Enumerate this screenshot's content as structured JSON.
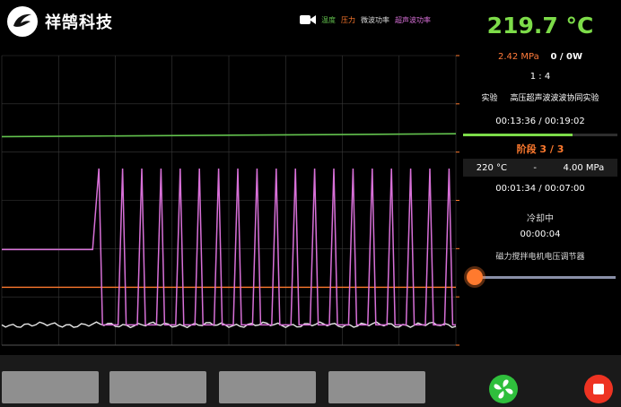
{
  "header": {
    "brand_name": "祥鹄科技",
    "legend": {
      "temperature": "温度",
      "pressure": "压力",
      "microwave_power": "微波功率",
      "ultrasonic_power": "超声波功率"
    }
  },
  "panel": {
    "temperature": "219.7 °C",
    "pressure": "2.42 MPa",
    "power": "0 / 0W",
    "ratio": "1 : 4",
    "experiment_label": "实验",
    "experiment_name": "高压超声波波波协同实验",
    "elapsed": "00:13:36",
    "total": "00:19:02",
    "progress": 0.71,
    "stage": "阶段 3 / 3",
    "stage_temp": "220 °C",
    "stage_sep": "-",
    "stage_pressure": "4.00 MPa",
    "stage_elapsed": "00:01:34",
    "stage_total": "00:07:00",
    "cooling_label": "冷却中",
    "cooling_time": "00:00:04",
    "motor_label": "磁力搅拌电机电压调节器",
    "motor_level": 0
  },
  "colors": {
    "temperature": "#63c34e",
    "pressure": "#ff7a2e",
    "microwave": "#e6e6e6",
    "ultrasonic": "#d870d8"
  },
  "chart_data": {
    "type": "line",
    "series": [
      {
        "name": "温度",
        "values": [
          [
            0,
            0.28
          ],
          [
            1,
            0.27
          ]
        ]
      },
      {
        "name": "压力",
        "values": [
          [
            0,
            0.8
          ],
          [
            1,
            0.8
          ]
        ]
      },
      {
        "name": "微波功率",
        "values": [
          [
            0,
            0.93
          ],
          [
            1,
            0.93
          ]
        ]
      },
      {
        "name": "超声波功率",
        "pulses": 19,
        "baseline_start": 0.67,
        "step_at": 0.2,
        "peak": 0.39
      }
    ]
  }
}
